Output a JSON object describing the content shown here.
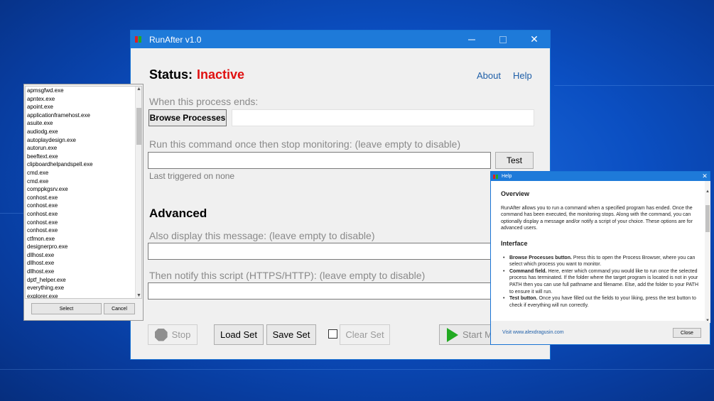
{
  "colors": {
    "titlebar": "#1e7ad9",
    "status_inactive": "#e01010",
    "link": "#1f5fa8",
    "start_green": "#22aa22"
  },
  "main_window": {
    "title": "RunAfter v1.0",
    "minimize_icon": "minimize-icon",
    "maximize_icon": "maximize-icon",
    "close_glyph": "✕",
    "status_label": "Status:",
    "status_value": "Inactive",
    "about_link": "About",
    "help_link": "Help",
    "process_label": "When this process ends:",
    "browse_button": "Browse Processes",
    "process_value": "",
    "command_label": "Run this command once then stop monitoring: (leave empty to disable)",
    "command_value": "",
    "test_button": "Test",
    "last_triggered": "Last triggered on none",
    "advanced_heading": "Advanced",
    "message_label": "Also display this message: (leave empty to disable)",
    "message_value": "",
    "script_label": "Then notify this script (HTTPS/HTTP): (leave empty to disable)",
    "script_value": "",
    "stop_button": "Stop",
    "load_button": "Load Set",
    "save_button": "Save Set",
    "clear_button": "Clear Set",
    "start_button": "Start Monitoring",
    "start_button_visible": "Start Mo"
  },
  "process_window": {
    "items": [
      "apmsgfwd.exe",
      "apntex.exe",
      "apoint.exe",
      "applicationframehost.exe",
      "asuite.exe",
      "audiodg.exe",
      "autoplaydesign.exe",
      "autorun.exe",
      "beeftext.exe",
      "clipboardhelpandspell.exe",
      "cmd.exe",
      "cmd.exe",
      "comppkgsrv.exe",
      "conhost.exe",
      "conhost.exe",
      "conhost.exe",
      "conhost.exe",
      "conhost.exe",
      "ctfmon.exe",
      "designerpro.exe",
      "dllhost.exe",
      "dllhost.exe",
      "dllhost.exe",
      "dptf_helper.exe",
      "everything.exe",
      "explorer.exe"
    ],
    "select_button": "Select",
    "cancel_button": "Cancel"
  },
  "help_window": {
    "title": "Help",
    "overview_heading": "Overview",
    "overview_text": "RunAfter allows you to run a command when a specified program has ended. Once the command has been executed, the monitoring stops. Along with the command, you can optionally display a message and/or notify a script of your choice. These options are for advanced users.",
    "interface_heading": "Interface",
    "bullets": [
      {
        "term": "Browse Processes button.",
        "text": " Press this to open the Process Browser, where you can select which process you want to monitor."
      },
      {
        "term": "Command field.",
        "text": " Here, enter which command you would like to run once the selected process has terminated. If the folder where the target program is located is not in your PATH then you can use full pathname and filename. Else, add the folder to your PATH to ensure it will run."
      },
      {
        "term": "Test button.",
        "text": " Once you have filled out the fields to your liking, press the test button to check if everything will run correctly."
      }
    ],
    "visit_link": "Visit www.alexdragusin.com",
    "close_button": "Close"
  }
}
